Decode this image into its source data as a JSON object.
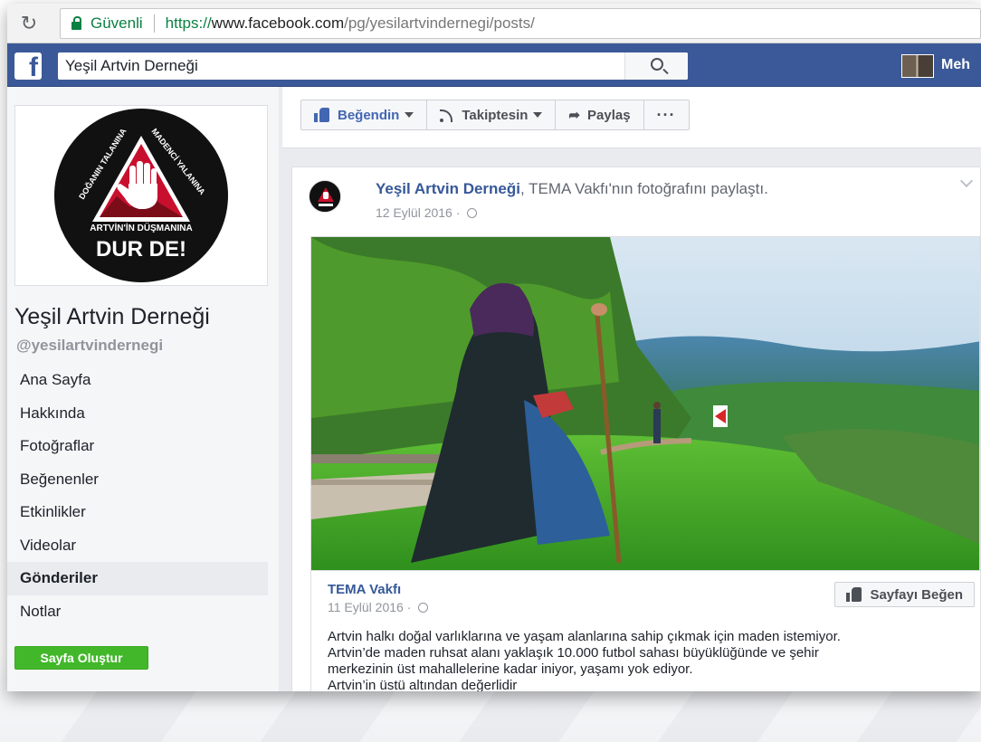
{
  "browser": {
    "secure_label": "Güvenli",
    "url_scheme": "https://",
    "url_host": "www.facebook.com",
    "url_path": "/pg/yesilartvindernegi/posts/"
  },
  "topbar": {
    "search_value": "Yeşil Artvin Derneği",
    "user_name": "Meh",
    "bar_color": "#3b5998"
  },
  "sidebar": {
    "logo_top_left": "DOĞANIN TALANINA",
    "logo_top_right": "MADENCİ YALANINA",
    "logo_bottom_small": "ARTVİN'İN DÜŞMANINA",
    "logo_bottom_big": "DUR DE!",
    "page_name": "Yeşil Artvin Derneği",
    "page_handle": "@yesilartvindernegi",
    "items": [
      {
        "label": "Ana Sayfa"
      },
      {
        "label": "Hakkında"
      },
      {
        "label": "Fotoğraflar"
      },
      {
        "label": "Beğenenler"
      },
      {
        "label": "Etkinlikler"
      },
      {
        "label": "Videolar"
      },
      {
        "label": "Gönderiler",
        "active": true
      },
      {
        "label": "Notlar"
      }
    ],
    "create_page_label": "Sayfa Oluştur"
  },
  "actions": {
    "liked_label": "Beğendin",
    "following_label": "Takiptesin",
    "share_label": "Paylaş",
    "more_label": "···"
  },
  "post": {
    "author": "Yeşil Artvin Derneği",
    "action_text": ", TEMA Vakfı'nın fotoğrafını paylaştı.",
    "date": "12 Eylül 2016 ·",
    "shared": {
      "source_name": "TEMA Vakfı",
      "source_date": "11 Eylül 2016 ·",
      "like_page_label": "Sayfayı Beğen",
      "description_lines": [
        "Artvin halkı doğal varlıklarına ve yaşam alanlarına sahip çıkmak için maden istemiyor.",
        "Artvin’de maden ruhsat alanı yaklaşık 10.000 futbol sahası büyüklüğünde ve şehir",
        "merkezinin üst mahallelerine kadar iniyor, yaşamı yok ediyor.",
        "Artvin’in üstü altından değerlidir"
      ]
    }
  },
  "colors": {
    "link": "#365899",
    "create_button": "#42b72a",
    "logo_red": "#c8102e"
  }
}
